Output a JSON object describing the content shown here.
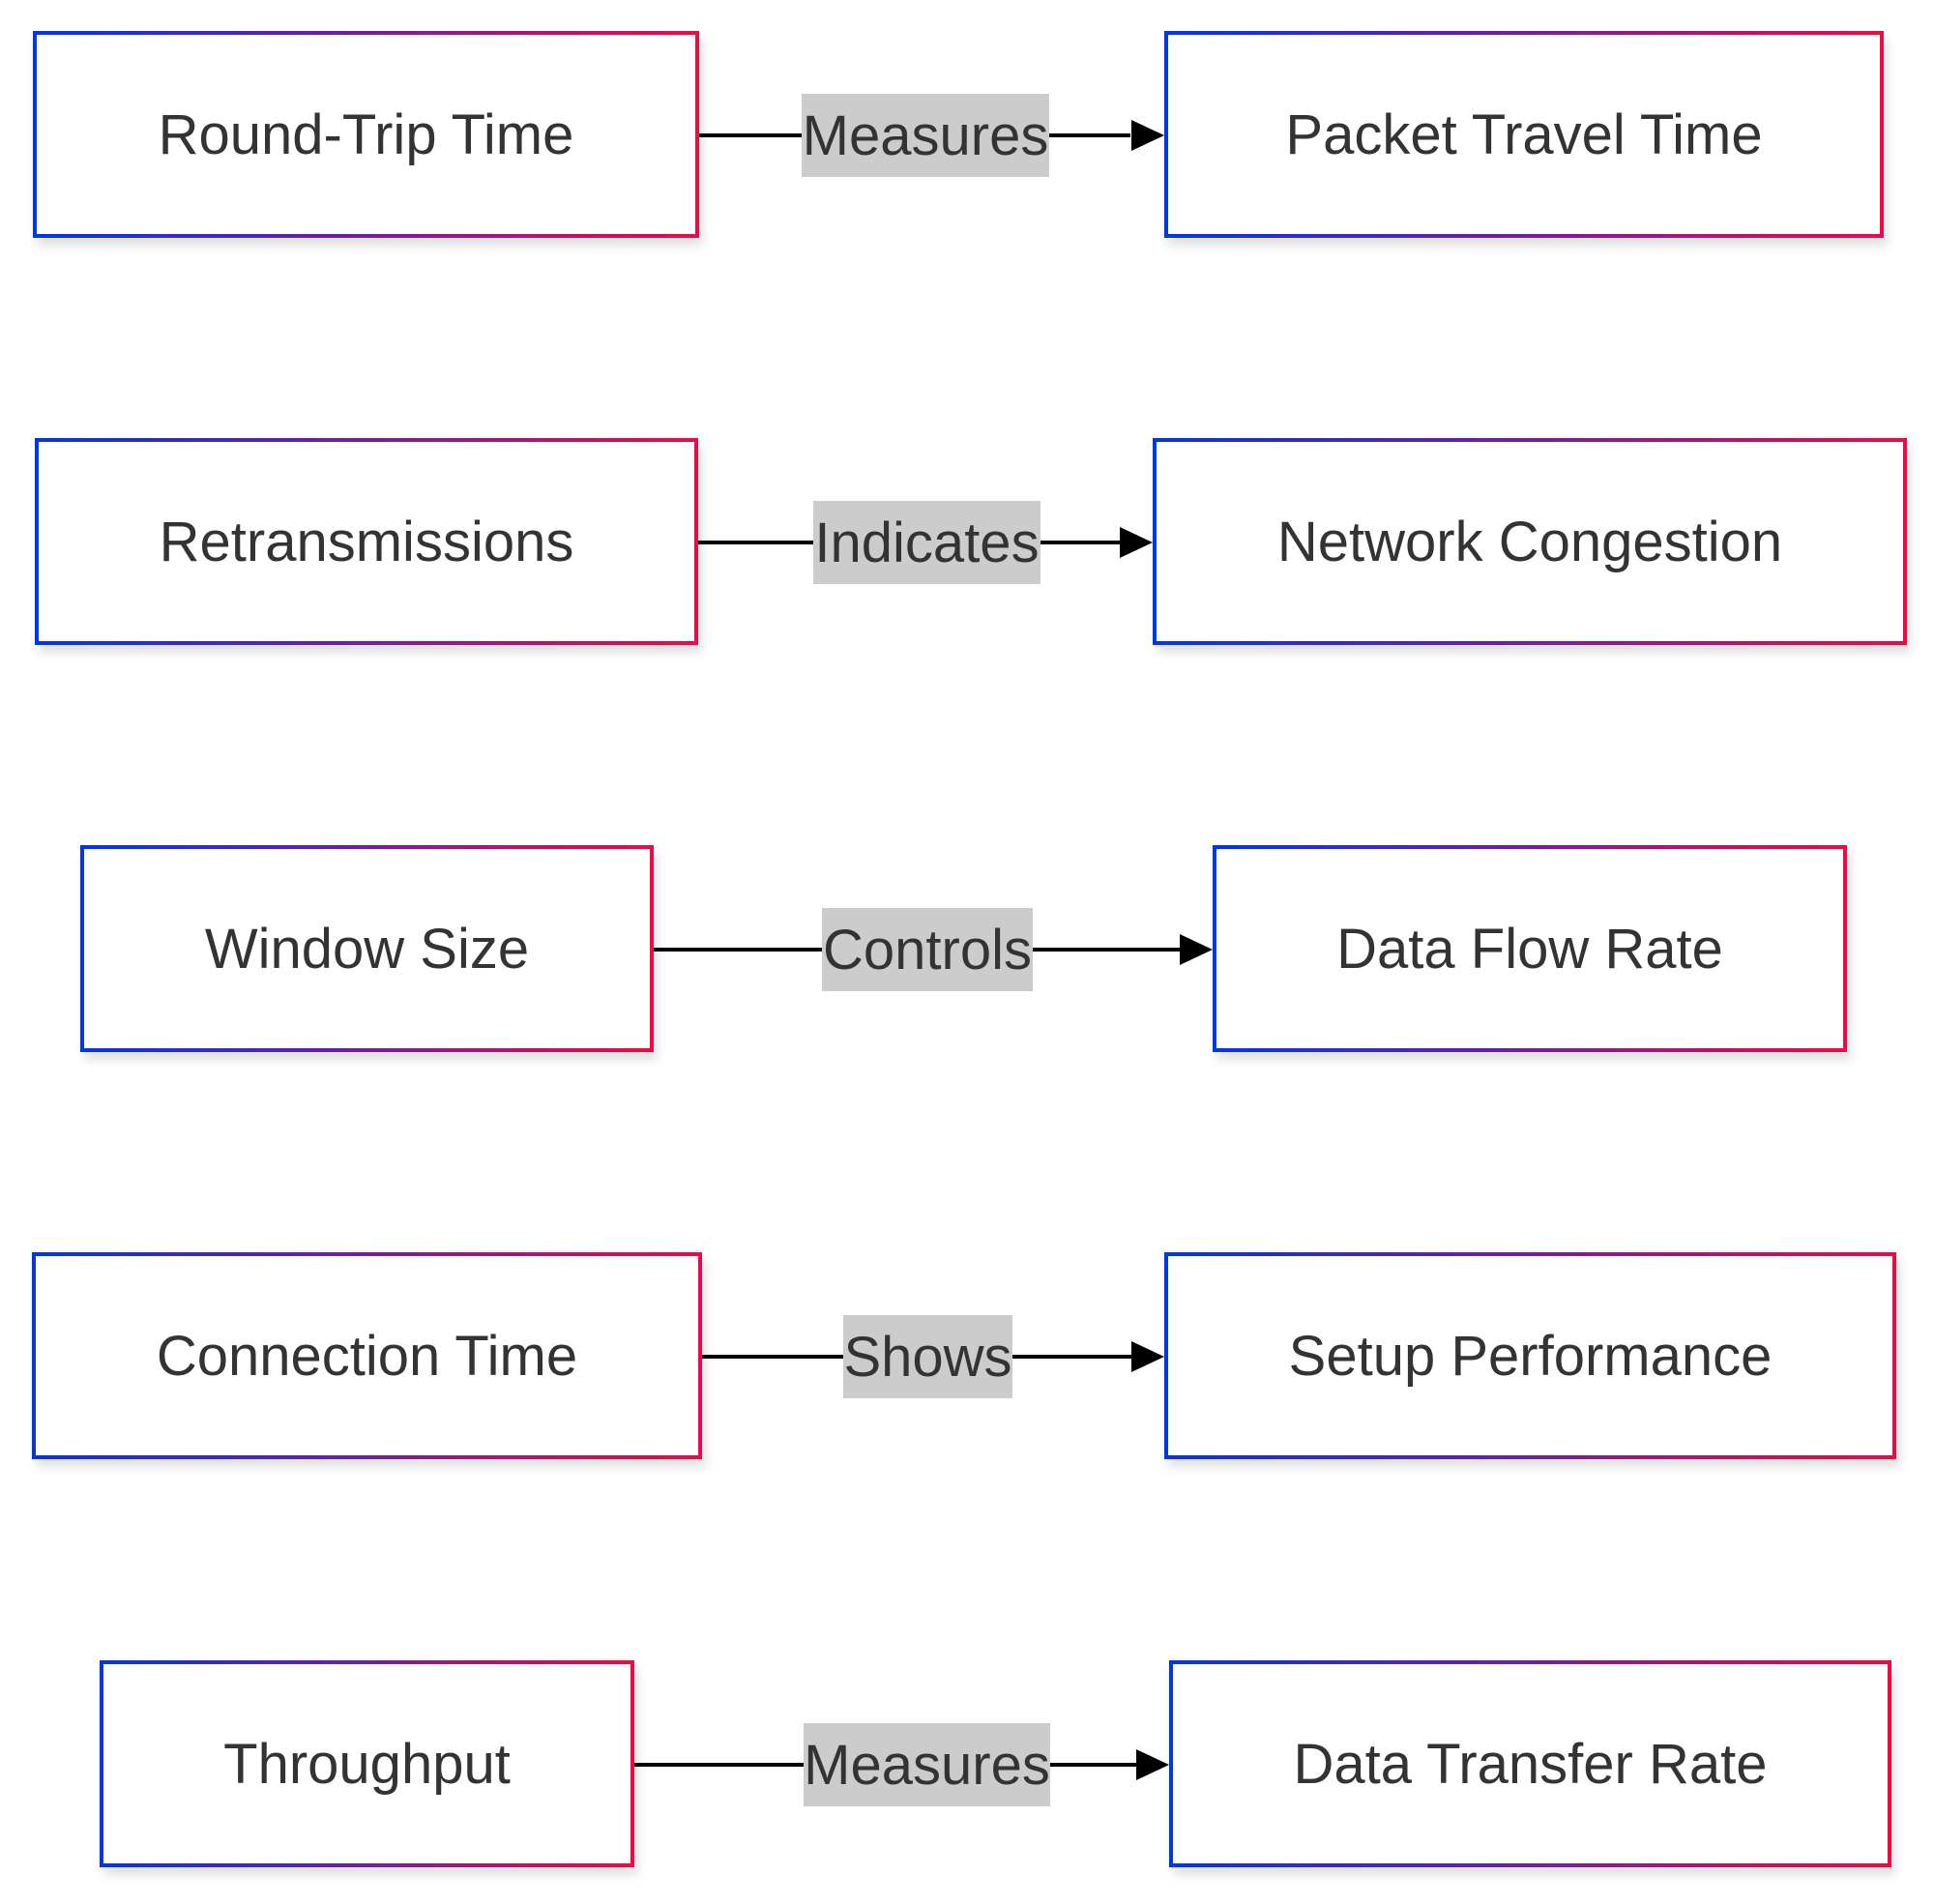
{
  "diagram": {
    "rows": [
      {
        "source": "Round-Trip Time",
        "relation": "Measures",
        "target": "Packet Travel Time"
      },
      {
        "source": "Retransmissions",
        "relation": "Indicates",
        "target": "Network Congestion"
      },
      {
        "source": "Window Size",
        "relation": "Controls",
        "target": "Data Flow Rate"
      },
      {
        "source": "Connection Time",
        "relation": "Shows",
        "target": "Setup Performance"
      },
      {
        "source": "Throughput",
        "relation": "Measures",
        "target": "Data Transfer Rate"
      }
    ],
    "colors": {
      "border_gradient_start": "#0036ea",
      "border_gradient_end": "#ee0a44",
      "edge_label_bg": "#cccccc",
      "text": "#333333",
      "edge": "#000000"
    }
  }
}
